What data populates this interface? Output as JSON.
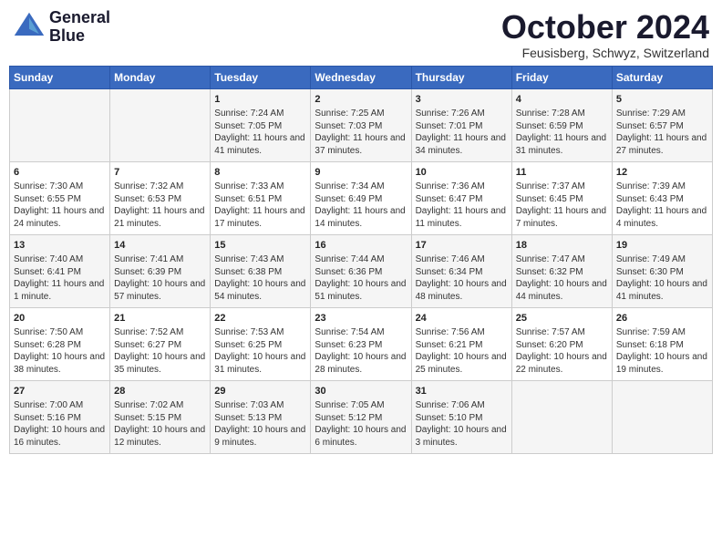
{
  "header": {
    "logo_line1": "General",
    "logo_line2": "Blue",
    "month": "October 2024",
    "location": "Feusisberg, Schwyz, Switzerland"
  },
  "weekdays": [
    "Sunday",
    "Monday",
    "Tuesday",
    "Wednesday",
    "Thursday",
    "Friday",
    "Saturday"
  ],
  "weeks": [
    [
      {
        "day": "",
        "content": ""
      },
      {
        "day": "",
        "content": ""
      },
      {
        "day": "1",
        "content": "Sunrise: 7:24 AM\nSunset: 7:05 PM\nDaylight: 11 hours and 41 minutes."
      },
      {
        "day": "2",
        "content": "Sunrise: 7:25 AM\nSunset: 7:03 PM\nDaylight: 11 hours and 37 minutes."
      },
      {
        "day": "3",
        "content": "Sunrise: 7:26 AM\nSunset: 7:01 PM\nDaylight: 11 hours and 34 minutes."
      },
      {
        "day": "4",
        "content": "Sunrise: 7:28 AM\nSunset: 6:59 PM\nDaylight: 11 hours and 31 minutes."
      },
      {
        "day": "5",
        "content": "Sunrise: 7:29 AM\nSunset: 6:57 PM\nDaylight: 11 hours and 27 minutes."
      }
    ],
    [
      {
        "day": "6",
        "content": "Sunrise: 7:30 AM\nSunset: 6:55 PM\nDaylight: 11 hours and 24 minutes."
      },
      {
        "day": "7",
        "content": "Sunrise: 7:32 AM\nSunset: 6:53 PM\nDaylight: 11 hours and 21 minutes."
      },
      {
        "day": "8",
        "content": "Sunrise: 7:33 AM\nSunset: 6:51 PM\nDaylight: 11 hours and 17 minutes."
      },
      {
        "day": "9",
        "content": "Sunrise: 7:34 AM\nSunset: 6:49 PM\nDaylight: 11 hours and 14 minutes."
      },
      {
        "day": "10",
        "content": "Sunrise: 7:36 AM\nSunset: 6:47 PM\nDaylight: 11 hours and 11 minutes."
      },
      {
        "day": "11",
        "content": "Sunrise: 7:37 AM\nSunset: 6:45 PM\nDaylight: 11 hours and 7 minutes."
      },
      {
        "day": "12",
        "content": "Sunrise: 7:39 AM\nSunset: 6:43 PM\nDaylight: 11 hours and 4 minutes."
      }
    ],
    [
      {
        "day": "13",
        "content": "Sunrise: 7:40 AM\nSunset: 6:41 PM\nDaylight: 11 hours and 1 minute."
      },
      {
        "day": "14",
        "content": "Sunrise: 7:41 AM\nSunset: 6:39 PM\nDaylight: 10 hours and 57 minutes."
      },
      {
        "day": "15",
        "content": "Sunrise: 7:43 AM\nSunset: 6:38 PM\nDaylight: 10 hours and 54 minutes."
      },
      {
        "day": "16",
        "content": "Sunrise: 7:44 AM\nSunset: 6:36 PM\nDaylight: 10 hours and 51 minutes."
      },
      {
        "day": "17",
        "content": "Sunrise: 7:46 AM\nSunset: 6:34 PM\nDaylight: 10 hours and 48 minutes."
      },
      {
        "day": "18",
        "content": "Sunrise: 7:47 AM\nSunset: 6:32 PM\nDaylight: 10 hours and 44 minutes."
      },
      {
        "day": "19",
        "content": "Sunrise: 7:49 AM\nSunset: 6:30 PM\nDaylight: 10 hours and 41 minutes."
      }
    ],
    [
      {
        "day": "20",
        "content": "Sunrise: 7:50 AM\nSunset: 6:28 PM\nDaylight: 10 hours and 38 minutes."
      },
      {
        "day": "21",
        "content": "Sunrise: 7:52 AM\nSunset: 6:27 PM\nDaylight: 10 hours and 35 minutes."
      },
      {
        "day": "22",
        "content": "Sunrise: 7:53 AM\nSunset: 6:25 PM\nDaylight: 10 hours and 31 minutes."
      },
      {
        "day": "23",
        "content": "Sunrise: 7:54 AM\nSunset: 6:23 PM\nDaylight: 10 hours and 28 minutes."
      },
      {
        "day": "24",
        "content": "Sunrise: 7:56 AM\nSunset: 6:21 PM\nDaylight: 10 hours and 25 minutes."
      },
      {
        "day": "25",
        "content": "Sunrise: 7:57 AM\nSunset: 6:20 PM\nDaylight: 10 hours and 22 minutes."
      },
      {
        "day": "26",
        "content": "Sunrise: 7:59 AM\nSunset: 6:18 PM\nDaylight: 10 hours and 19 minutes."
      }
    ],
    [
      {
        "day": "27",
        "content": "Sunrise: 7:00 AM\nSunset: 5:16 PM\nDaylight: 10 hours and 16 minutes."
      },
      {
        "day": "28",
        "content": "Sunrise: 7:02 AM\nSunset: 5:15 PM\nDaylight: 10 hours and 12 minutes."
      },
      {
        "day": "29",
        "content": "Sunrise: 7:03 AM\nSunset: 5:13 PM\nDaylight: 10 hours and 9 minutes."
      },
      {
        "day": "30",
        "content": "Sunrise: 7:05 AM\nSunset: 5:12 PM\nDaylight: 10 hours and 6 minutes."
      },
      {
        "day": "31",
        "content": "Sunrise: 7:06 AM\nSunset: 5:10 PM\nDaylight: 10 hours and 3 minutes."
      },
      {
        "day": "",
        "content": ""
      },
      {
        "day": "",
        "content": ""
      }
    ]
  ]
}
